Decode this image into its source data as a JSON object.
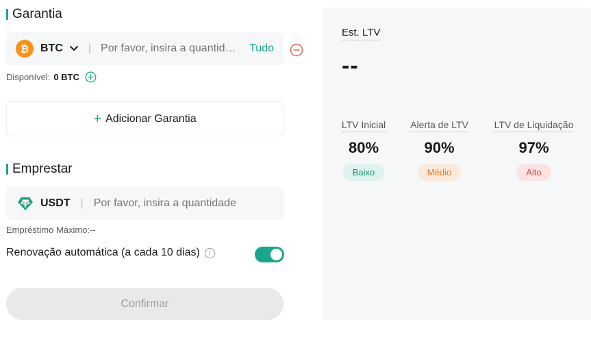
{
  "collateral": {
    "title": "Garantia",
    "coin": "BTC",
    "placeholder": "Por favor, insira a quantidade",
    "max_label": "Tudo",
    "available_label": "Disponível:",
    "available_value": "0 BTC",
    "add_label": "Adicionar Garantia"
  },
  "borrow": {
    "title": "Emprestar",
    "coin": "USDT",
    "placeholder": "Por favor, insira a quantidade",
    "max_loan_label": "Empréstimo Máximo:",
    "max_loan_value": "--",
    "renew_label": "Renovação automática (a cada 10 dias)",
    "renew_enabled": true,
    "confirm_label": "Confirmar"
  },
  "ltv_panel": {
    "est_label": "Est. LTV",
    "est_value": "--",
    "columns": [
      {
        "label": "LTV Inicial",
        "value": "80%",
        "level": "Baixo"
      },
      {
        "label": "Alerta de LTV",
        "value": "90%",
        "level": "Médio"
      },
      {
        "label": "LTV de Liquidação",
        "value": "97%",
        "level": "Alto"
      }
    ]
  },
  "colors": {
    "accent": "#1aa58c",
    "btc": "#f7931a",
    "usdt": "#26a17b",
    "remove": "#e0664f",
    "low_bg": "#dff3ee",
    "low_fg": "#1a8f78",
    "mid_bg": "#fbeadc",
    "mid_fg": "#e07a2c",
    "high_bg": "#fbe3e3",
    "high_fg": "#d9443d"
  },
  "icons": {
    "btc": "btc-coin-icon",
    "usdt": "usdt-coin-icon",
    "dropdown": "chevron-down-icon",
    "remove": "minus-circle-icon",
    "add_small": "plus-circle-icon",
    "add": "plus-icon",
    "info": "info-icon"
  }
}
